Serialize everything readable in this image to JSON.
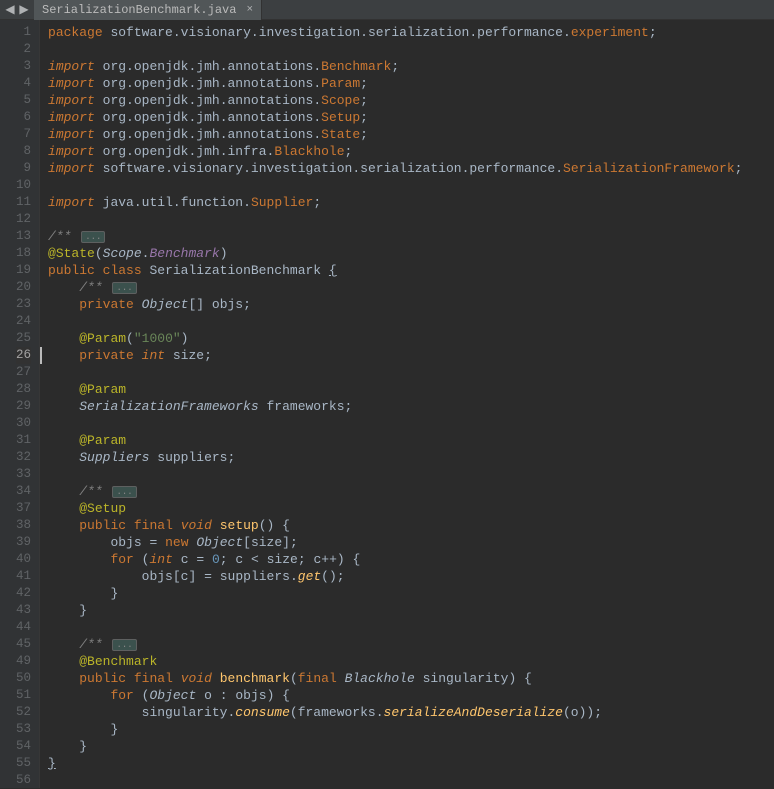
{
  "tab": {
    "filename": "SerializationBenchmark.java"
  },
  "gutter_lines": [
    "1",
    "2",
    "3",
    "4",
    "5",
    "6",
    "7",
    "8",
    "9",
    "10",
    "11",
    "12",
    "13",
    "18",
    "19",
    "20",
    "23",
    "24",
    "25",
    "26",
    "27",
    "28",
    "29",
    "30",
    "31",
    "32",
    "33",
    "34",
    "37",
    "38",
    "39",
    "40",
    "41",
    "42",
    "43",
    "44",
    "45",
    "49",
    "50",
    "51",
    "52",
    "53",
    "54",
    "55",
    "56"
  ],
  "current_line_index": 19,
  "tokens": {
    "kw_package": "package",
    "kw_import": "import",
    "kw_public": "public",
    "kw_private": "private",
    "kw_class": "class",
    "kw_final": "final",
    "kw_void": "void",
    "kw_int": "int",
    "kw_for": "for",
    "kw_new": "new",
    "pkg_software": "software",
    "pkg_visionary": "visionary",
    "pkg_investigation": "investigation",
    "pkg_serialization": "serialization",
    "pkg_performance": "performance",
    "pkg_experiment": "experiment",
    "pkg_org": "org",
    "pkg_openjdk": "openjdk",
    "pkg_jmh": "jmh",
    "pkg_annotations": "annotations",
    "pkg_infra": "infra",
    "pkg_java": "java",
    "pkg_util": "util",
    "pkg_function": "function",
    "cls_benchmark": "Benchmark",
    "cls_param": "Param",
    "cls_scope": "Scope",
    "cls_setup": "Setup",
    "cls_state": "State",
    "cls_blackhole": "Blackhole",
    "cls_serfw": "SerializationFramework",
    "cls_supplier": "Supplier",
    "cls_serbench": "SerializationBenchmark",
    "cls_object": "Object",
    "cls_serfws": "SerializationFrameworks",
    "cls_suppliers": "Suppliers",
    "anno_state": "@State",
    "anno_param": "@Param",
    "anno_setup": "@Setup",
    "anno_bench": "@Benchmark",
    "scope_bench": "Benchmark",
    "fld_objs": "objs",
    "fld_size": "size",
    "fld_frameworks": "frameworks",
    "fld_suppliers": "suppliers",
    "mth_setup": "setup",
    "mth_benchmark": "benchmark",
    "mth_get": "get",
    "mth_consume": "consume",
    "mth_sad": "serializeAndDeserialize",
    "var_c": "c",
    "var_o": "o",
    "var_singularity": "singularity",
    "str_1000": "\"1000\"",
    "num_0": "0",
    "doc": "/**",
    "fold": "..."
  }
}
